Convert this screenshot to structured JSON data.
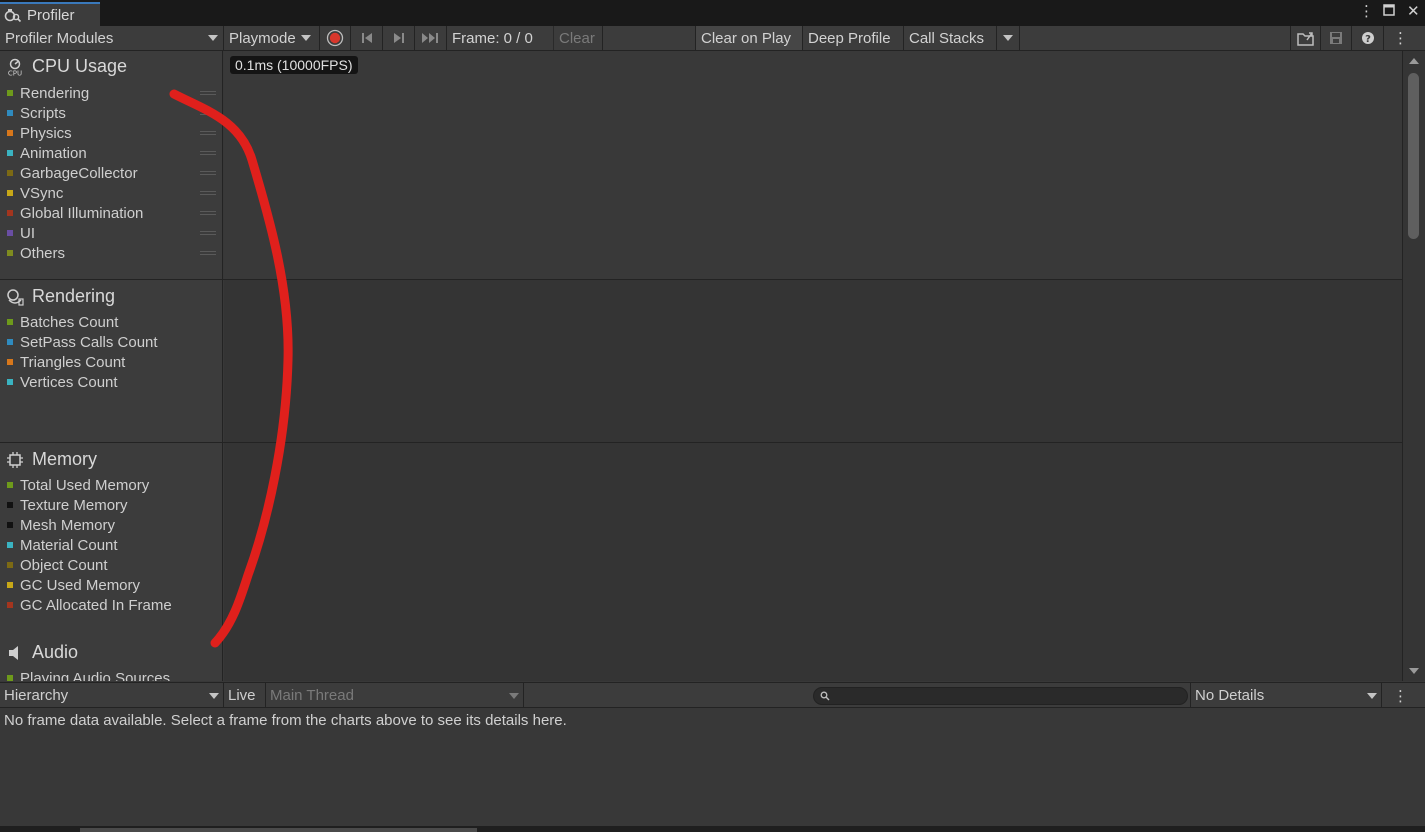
{
  "window": {
    "tab_title": "Profiler",
    "tab_icon": "profiler-icon",
    "controls": [
      "more-icon",
      "maximize-icon",
      "close-icon"
    ]
  },
  "toolbar": {
    "modules_dropdown": "Profiler Modules",
    "target_dropdown": "Playmode",
    "record_icon": "record-icon",
    "prev_frame_icon": "previous-frame-icon",
    "next_frame_icon": "next-frame-icon",
    "last_frame_icon": "last-frame-icon",
    "frame_label": "Frame: 0 / 0",
    "clear": "Clear",
    "clear_on_play": "Clear on Play",
    "deep_profile": "Deep Profile",
    "call_stacks": "Call Stacks",
    "load_icon": "load-icon",
    "save_icon": "save-icon",
    "help_icon": "help-icon",
    "menu_icon": "menu-icon"
  },
  "modules": [
    {
      "title": "CPU Usage",
      "icon": "cpu-icon",
      "counters": [
        {
          "label": "Rendering",
          "color": "#6e9a1b"
        },
        {
          "label": "Scripts",
          "color": "#2f8bbf"
        },
        {
          "label": "Physics",
          "color": "#d7771b"
        },
        {
          "label": "Animation",
          "color": "#3ab3c1"
        },
        {
          "label": "GarbageCollector",
          "color": "#7c6a14"
        },
        {
          "label": "VSync",
          "color": "#c8a818"
        },
        {
          "label": "Global Illumination",
          "color": "#a3351e"
        },
        {
          "label": "UI",
          "color": "#6a4ea4"
        },
        {
          "label": "Others",
          "color": "#7f8c1f"
        }
      ]
    },
    {
      "title": "Rendering",
      "icon": "rendering-icon",
      "counters": [
        {
          "label": "Batches Count",
          "color": "#6e9a1b"
        },
        {
          "label": "SetPass Calls Count",
          "color": "#2f8bbf"
        },
        {
          "label": "Triangles Count",
          "color": "#d7771b"
        },
        {
          "label": "Vertices Count",
          "color": "#3ab3c1"
        }
      ]
    },
    {
      "title": "Memory",
      "icon": "memory-icon",
      "counters": [
        {
          "label": "Total Used Memory",
          "color": "#6e9a1b"
        },
        {
          "label": "Texture Memory",
          "color": "#111111"
        },
        {
          "label": "Mesh Memory",
          "color": "#111111"
        },
        {
          "label": "Material Count",
          "color": "#3ab3c1"
        },
        {
          "label": "Object Count",
          "color": "#7c6a14"
        },
        {
          "label": "GC Used Memory",
          "color": "#c8a818"
        },
        {
          "label": "GC Allocated In Frame",
          "color": "#a3351e"
        }
      ]
    },
    {
      "title": "Audio",
      "icon": "audio-icon",
      "counters": [
        {
          "label": "Playing Audio Sources",
          "color": "#6e9a1b"
        }
      ]
    }
  ],
  "chart": {
    "cpu_scale_label": "0.1ms (10000FPS)"
  },
  "bottom_toolbar": {
    "view_dropdown": "Hierarchy",
    "live": "Live",
    "thread_dropdown": "Main Thread",
    "search_placeholder": "",
    "details_dropdown": "No Details",
    "menu_icon": "menu-icon"
  },
  "details": {
    "message": "No frame data available. Select a frame from the charts above to see its details here."
  },
  "colors": {
    "annotation": "#e0201c",
    "record_button": "#d8372c"
  }
}
